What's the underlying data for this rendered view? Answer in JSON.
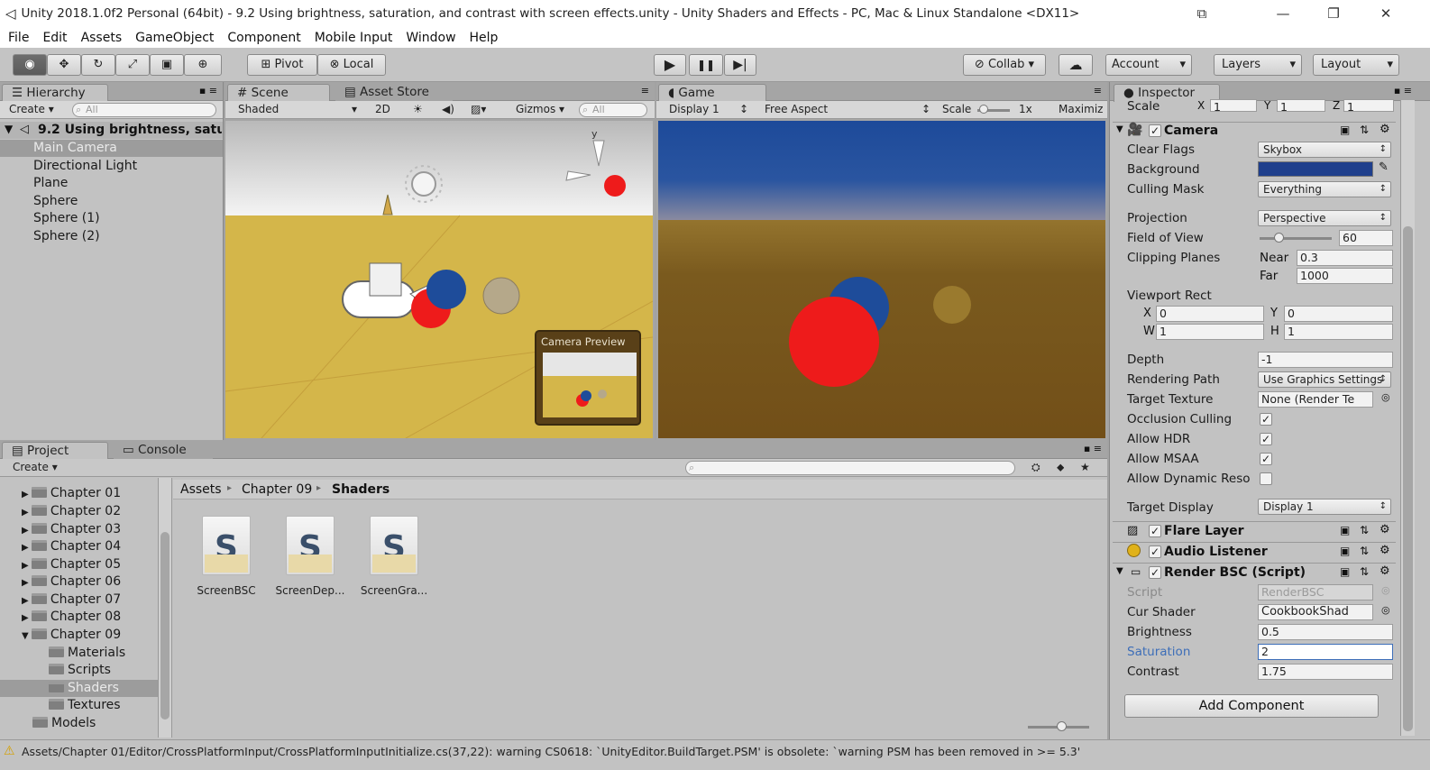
{
  "window": {
    "title": "Unity 2018.1.0f2 Personal (64bit) - 9.2 Using brightness, saturation, and contrast with screen effects.unity - Unity Shaders and Effects - PC, Mac & Linux Standalone <DX11>",
    "minimize": "—",
    "maximize": "❐",
    "close": "✕",
    "extra": "⧉"
  },
  "menu": [
    "File",
    "Edit",
    "Assets",
    "GameObject",
    "Component",
    "Mobile Input",
    "Window",
    "Help"
  ],
  "toolbar": {
    "pivot": "Pivot",
    "local": "Local",
    "play": "▶",
    "pause": "❚❚",
    "step": "▶|",
    "collab": "Collab ▾",
    "cloud": "☁",
    "account": "Account",
    "layers": "Layers",
    "layout": "Layout"
  },
  "hierarchy": {
    "tab": "Hierarchy",
    "create": "Create ▾",
    "search": "All",
    "scene": "9.2 Using brightness, satu",
    "items": [
      "Main Camera",
      "Directional Light",
      "Plane",
      "Sphere",
      "Sphere (1)",
      "Sphere (2)"
    ]
  },
  "scene": {
    "tab": "Scene",
    "asset_store_tab": "Asset Store",
    "shading": "Shaded",
    "mode_2d": "2D",
    "gizmos": "Gizmos ▾",
    "search": "All",
    "camera_preview": "Camera Preview",
    "gizmo_y": "y"
  },
  "game": {
    "tab": "Game",
    "display": "Display 1",
    "aspect": "Free Aspect",
    "scale_label": "Scale",
    "scale_value": "1x",
    "maximize": "Maximiz"
  },
  "inspector": {
    "tab": "Inspector",
    "scale_label": "Scale",
    "scale_x_label": "X",
    "scale_x": "1",
    "scale_y_label": "Y",
    "scale_y": "1",
    "scale_z_label": "Z",
    "scale_z": "1",
    "camera": {
      "title": "Camera",
      "clear_flags_label": "Clear Flags",
      "clear_flags": "Skybox",
      "background_label": "Background",
      "culling_mask_label": "Culling Mask",
      "culling_mask": "Everything",
      "projection_label": "Projection",
      "projection": "Perspective",
      "fov_label": "Field of View",
      "fov": "60",
      "fov_fraction": 0.2,
      "clipping_label": "Clipping Planes",
      "near_label": "Near",
      "near": "0.3",
      "far_label": "Far",
      "far": "1000",
      "viewport_label": "Viewport Rect",
      "vx_label": "X",
      "vx": "0",
      "vy_label": "Y",
      "vy": "0",
      "vw_label": "W",
      "vw": "1",
      "vh_label": "H",
      "vh": "1",
      "depth_label": "Depth",
      "depth": "-1",
      "rendering_path_label": "Rendering Path",
      "rendering_path": "Use Graphics Settings",
      "target_texture_label": "Target Texture",
      "target_texture": "None (Render Te",
      "occlusion_label": "Occlusion Culling",
      "hdr_label": "Allow HDR",
      "msaa_label": "Allow MSAA",
      "dynres_label": "Allow Dynamic Reso",
      "target_display_label": "Target Display",
      "target_display": "Display 1",
      "background_color": "#1f3f8c"
    },
    "flare_layer": "Flare Layer",
    "audio_listener": "Audio Listener",
    "render_bsc": {
      "title": "Render BSC (Script)",
      "script_label": "Script",
      "script": "RenderBSC",
      "cur_shader_label": "Cur Shader",
      "cur_shader": "CookbookShad",
      "brightness_label": "Brightness",
      "brightness": "0.5",
      "saturation_label": "Saturation",
      "saturation": "2",
      "contrast_label": "Contrast",
      "contrast": "1.75"
    },
    "add_component": "Add Component"
  },
  "project": {
    "tab": "Project",
    "console_tab": "Console",
    "create": "Create ▾",
    "breadcrumb": [
      "Assets",
      "Chapter 09",
      "Shaders"
    ],
    "folders": [
      "Chapter 01",
      "Chapter 02",
      "Chapter 03",
      "Chapter 04",
      "Chapter 05",
      "Chapter 06",
      "Chapter 07",
      "Chapter 08",
      "Chapter 09"
    ],
    "subfolders": [
      "Materials",
      "Scripts",
      "Shaders",
      "Textures"
    ],
    "models": "Models",
    "files": [
      "ScreenBSC",
      "ScreenDep...",
      "ScreenGra..."
    ],
    "file_glyph": "S"
  },
  "status": {
    "message": "Assets/Chapter 01/Editor/CrossPlatformInput/CrossPlatformInputInitialize.cs(37,22): warning CS0618: `UnityEditor.BuildTarget.PSM' is obsolete: `warning PSM has been removed in >= 5.3'"
  },
  "colors": {
    "game_sky": "#1d4a9a",
    "game_ground": "#7a5a1e",
    "scene_ground": "#d4b64a",
    "red_sphere": "#ee1b1b",
    "blue_sphere": "#1e4c9a",
    "accent_blue": "#3d6eb8"
  }
}
